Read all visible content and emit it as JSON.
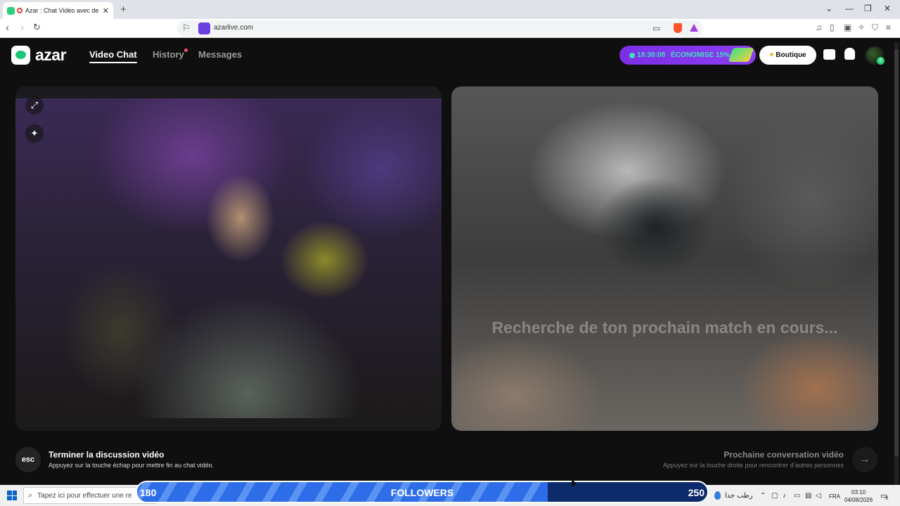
{
  "browser": {
    "tab_title": "Azar : Chat Vidéo avec de no",
    "url": "azarlive.com",
    "new_tab_icon": "+",
    "close_icon": "✕"
  },
  "header": {
    "logo_text": "azar",
    "nav": {
      "video_chat": "Video Chat",
      "history": "History",
      "messages": "Messages"
    },
    "promo": {
      "timer": "18:30:08",
      "saving": "ÉCONOMISE 15%"
    },
    "boutique_label": "Boutique",
    "avatar_badge": "6"
  },
  "remote": {
    "status": "Recherche de ton prochain match en cours..."
  },
  "hints": {
    "esc_key": "esc",
    "end_title": "Terminer la discussion vidéo",
    "end_sub": "Appuyez sur la touche échap pour mettre fin au chat vidéo.",
    "next_title": "Prochaine conversation vidéo",
    "next_sub": "Appuyez sur la touche droite pour rencontrer d’autres personnes"
  },
  "followers": {
    "start": "180",
    "end": "250",
    "label": "FOLLOWERS",
    "progress": 0.72
  },
  "taskbar": {
    "search_placeholder": "Tapez ici pour effectuer une re",
    "weather_text": "رطب جدا",
    "lang": "FRA",
    "time": "03:10",
    "date": "04/08/2026",
    "notif_count": "9"
  },
  "colors": {
    "accent_green": "#18c878",
    "promo_purple": "#7b2fe6",
    "bar_blue": "#2d6ee8"
  }
}
